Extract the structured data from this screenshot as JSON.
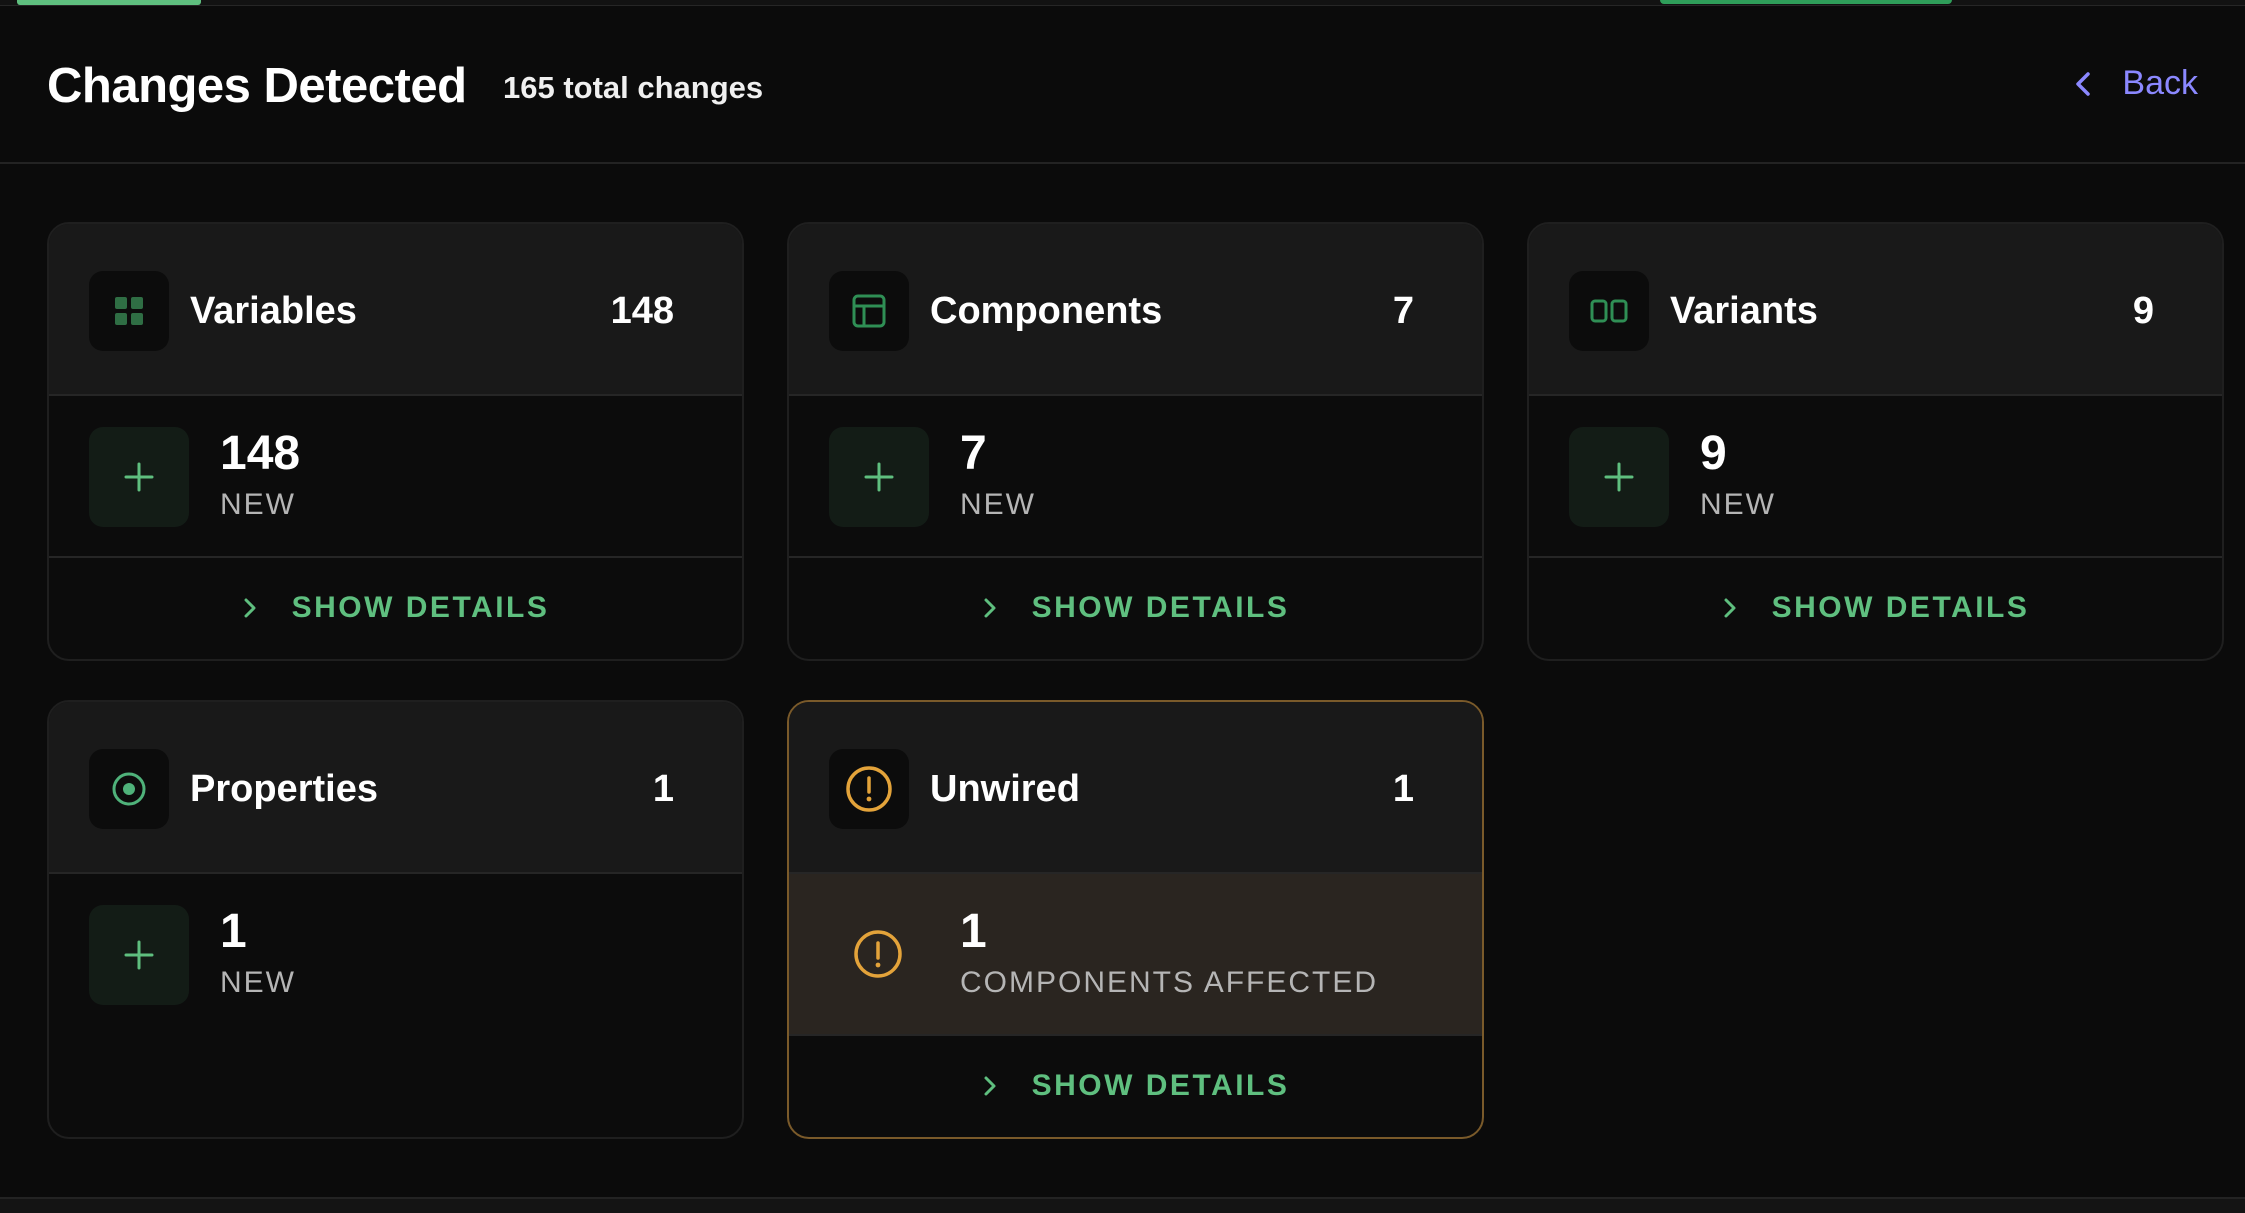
{
  "header": {
    "title": "Changes Detected",
    "subtitle": "165 total changes",
    "back_label": "Back"
  },
  "colors": {
    "accent_green": "#5fbf7f",
    "accent_purple": "#8b88ff",
    "warning_orange": "#e3a33a",
    "background": "#0b0b0b"
  },
  "cards": [
    {
      "name": "Variables",
      "count": "148",
      "icon": "grid-icon",
      "value": "148",
      "label": "NEW",
      "details": "SHOW DETAILS"
    },
    {
      "name": "Components",
      "count": "7",
      "icon": "layout-icon",
      "value": "7",
      "label": "NEW",
      "details": "SHOW DETAILS"
    },
    {
      "name": "Variants",
      "count": "9",
      "icon": "columns-icon",
      "value": "9",
      "label": "NEW",
      "details": "SHOW DETAILS"
    },
    {
      "name": "Properties",
      "count": "1",
      "icon": "target-icon",
      "value": "1",
      "label": "NEW"
    },
    {
      "name": "Unwired",
      "count": "1",
      "icon": "warning-icon",
      "value": "1",
      "label": "COMPONENTS AFFECTED",
      "details": "SHOW DETAILS"
    }
  ]
}
